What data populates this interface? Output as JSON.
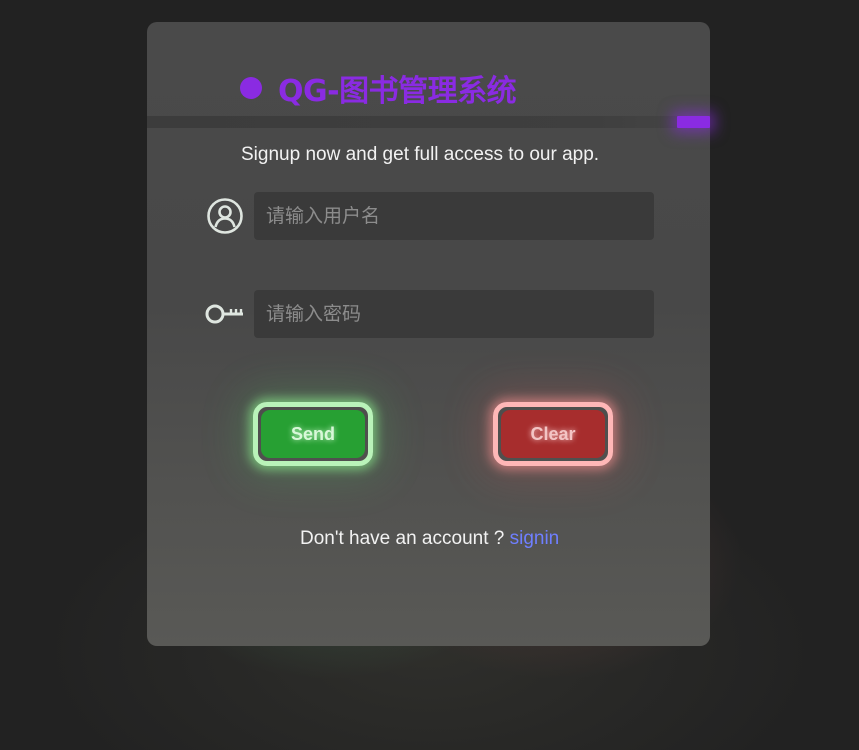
{
  "app": {
    "title": "QG-图书管理系统",
    "accent_color": "#8a2be2"
  },
  "form": {
    "subtitle": "Signup now and get full access to our app.",
    "username": {
      "icon": "user-circle-icon",
      "value": "",
      "placeholder": "请输入用户名"
    },
    "password": {
      "icon": "key-icon",
      "value": "",
      "placeholder": "请输入密码"
    }
  },
  "buttons": {
    "send_label": "Send",
    "clear_label": "Clear",
    "send_color": "#27a033",
    "clear_color": "#a72d2d"
  },
  "footer": {
    "prompt": "Don't have an account ? ",
    "link_label": "signin",
    "link_color": "#6f7fff"
  }
}
